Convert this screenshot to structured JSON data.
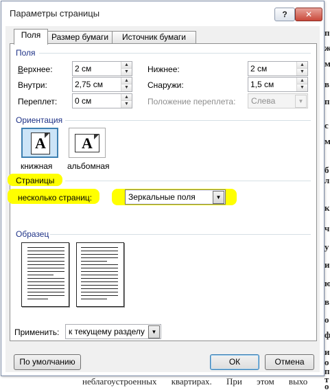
{
  "background": {
    "right_chars": [
      "п",
      "ж",
      "м",
      "в",
      "п",
      "с",
      "м",
      "б",
      "л",
      "к",
      "ч",
      "у",
      "и",
      "ю",
      "в",
      "о",
      "ф",
      "и",
      "о",
      "п",
      "т",
      "о"
    ],
    "bottom_line": "неблагоустроенных квартирах. При этом выхо"
  },
  "dialog": {
    "title": "Параметры страницы",
    "help_label": "?",
    "close_label": "✕",
    "tabs": [
      {
        "label": "Поля",
        "active": true
      },
      {
        "label": "Размер бумаги",
        "active": false
      },
      {
        "label": "Источник бумаги",
        "active": false
      }
    ],
    "margins": {
      "group_label": "Поля",
      "top_label": "Верхнее:",
      "top_value": "2 см",
      "inside_label": "Внутри:",
      "inside_value": "2,75 см",
      "gutter_label": "Переплет:",
      "gutter_value": "0 см",
      "bottom_label": "Нижнее:",
      "bottom_value": "2 см",
      "outside_label": "Снаружи:",
      "outside_value": "1,5 см",
      "gutter_pos_label": "Положение переплета:",
      "gutter_pos_value": "Слева"
    },
    "orientation": {
      "group_label": "Ориентация",
      "portrait_label": "книжная",
      "landscape_label": "альбомная",
      "glyph": "A"
    },
    "pages": {
      "group_label": "Страницы",
      "multiple_label": "несколько страниц:",
      "multiple_value": "Зеркальные поля"
    },
    "preview": {
      "group_label": "Образец"
    },
    "apply": {
      "label": "Применить:",
      "value": "к текущему разделу"
    },
    "buttons": {
      "default_label": "По умолчанию",
      "ok_label": "ОК",
      "cancel_label": "Отмена"
    },
    "colors": {
      "group_label": "#1e3287",
      "highlight": "#ffff00",
      "selection": "#cce4f7"
    }
  }
}
